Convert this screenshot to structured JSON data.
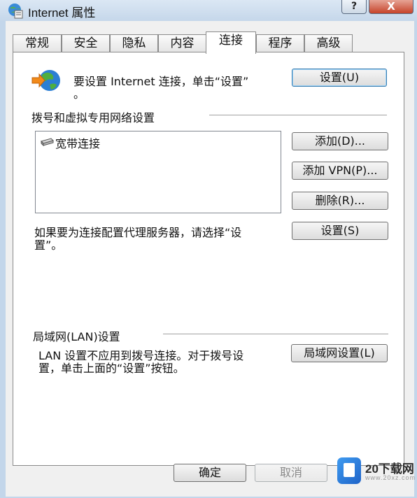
{
  "window": {
    "title": "Internet 属性",
    "help_label": "?",
    "close_label": "X"
  },
  "tabs": [
    {
      "label": "常规"
    },
    {
      "label": "安全"
    },
    {
      "label": "隐私"
    },
    {
      "label": "内容"
    },
    {
      "label": "连接",
      "active": true
    },
    {
      "label": "程序"
    },
    {
      "label": "高级"
    }
  ],
  "setup": {
    "text_line1": "要设置 Internet 连接，单击“设置”",
    "text_line2": "。",
    "button_label": "设置(U)"
  },
  "dialup": {
    "section_title": "拨号和虚拟专用网络设置",
    "connections": [
      {
        "label": "宽带连接",
        "icon": "modem-icon"
      }
    ],
    "add_label": "添加(D)...",
    "add_vpn_label": "添加 VPN(P)...",
    "remove_label": "删除(R)...",
    "proxy_text": "如果要为连接配置代理服务器，请选择“设",
    "proxy_text_cont": "置”。",
    "settings_label": "设置(S)"
  },
  "lan": {
    "section_title": "局域网(LAN)设置",
    "text_line1": "LAN 设置不应用到拨号连接。对于拨号设",
    "text_line2": "置，单击上面的“设置”按钮。",
    "button_label": "局域网设置(L)"
  },
  "footer": {
    "ok_label": "确定",
    "cancel_label": "取消"
  },
  "watermark": {
    "title": "20下载网",
    "subtitle": "www.20xz.com"
  },
  "colors": {
    "frame": "#c3d6ea",
    "client": "#f0f0f0",
    "accent_border": "#3c7fb1",
    "close_button": "#c6432a"
  }
}
